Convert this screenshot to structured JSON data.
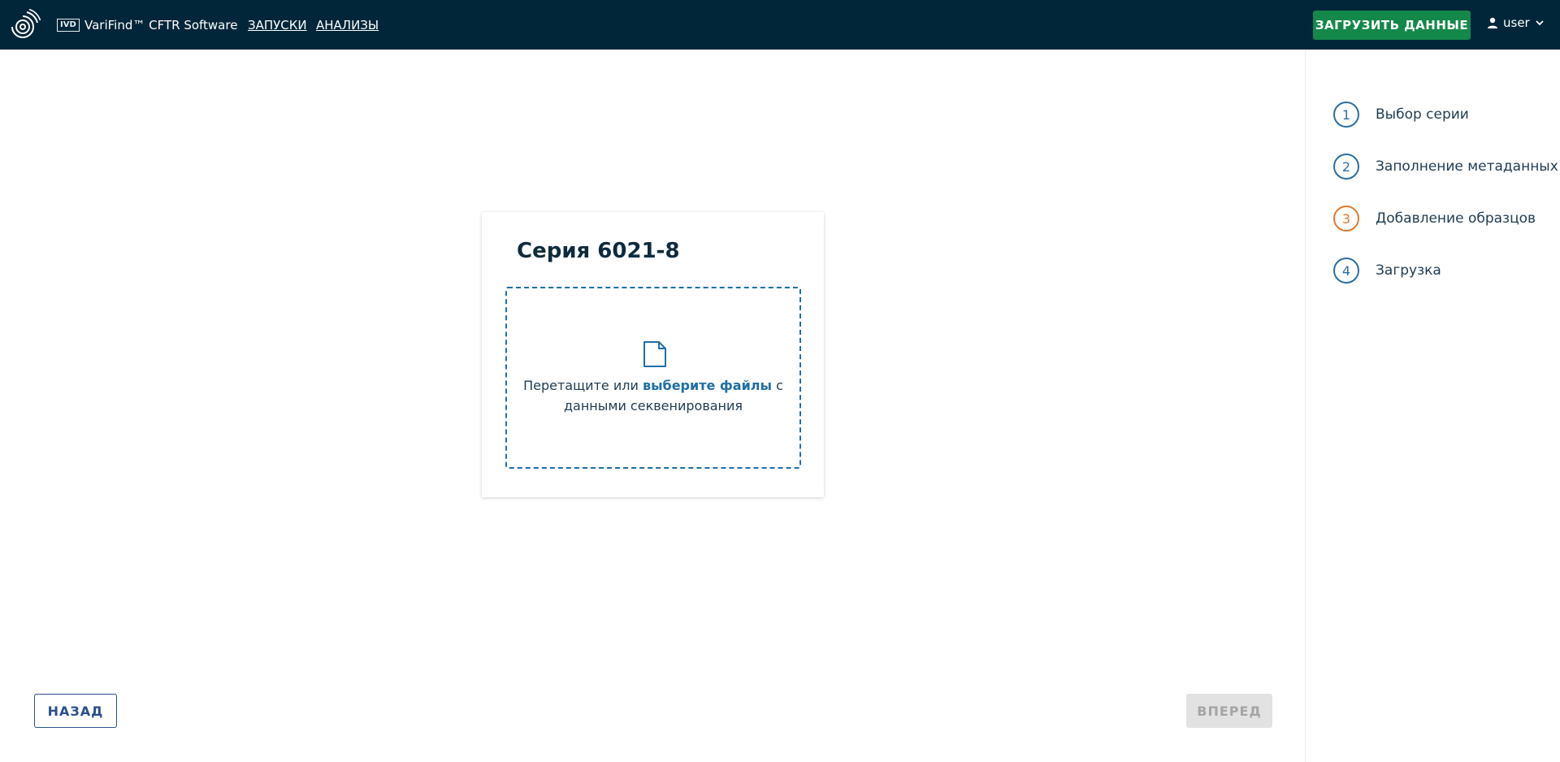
{
  "header": {
    "logo_icon": "target-rings-logo",
    "ivd_badge": "IVD",
    "app_name": "VariFind™ CFTR Software",
    "nav": [
      {
        "label": "ЗАПУСКИ"
      },
      {
        "label": "АНАЛИЗЫ"
      }
    ],
    "upload_button": "ЗАГРУЗИТЬ ДАННЫЕ",
    "user_icon": "person-icon",
    "user_name": "user",
    "user_chevron": "chevron-down-icon"
  },
  "steps": [
    {
      "number": "1",
      "label": "Выбор серии",
      "state": "done"
    },
    {
      "number": "2",
      "label": "Заполнение метаданных",
      "state": "done"
    },
    {
      "number": "3",
      "label": "Добавление образцов",
      "state": "active"
    },
    {
      "number": "4",
      "label": "Загрузка",
      "state": "pending"
    }
  ],
  "card": {
    "title": "Серия 6021-8",
    "dropzone": {
      "icon": "file-icon",
      "text_before": "Перетащите или ",
      "link": "выберите файлы",
      "text_after": " с данными секвенирования"
    }
  },
  "footer": {
    "back_button": "НАЗАД",
    "next_button": "ВПЕРЕД"
  },
  "colors": {
    "header_bg": "#022639",
    "upload_green": "#13884a",
    "step_blue": "#2a6fa8",
    "step_active_orange": "#e07a2e",
    "dropzone_blue": "#1f6fa6"
  }
}
